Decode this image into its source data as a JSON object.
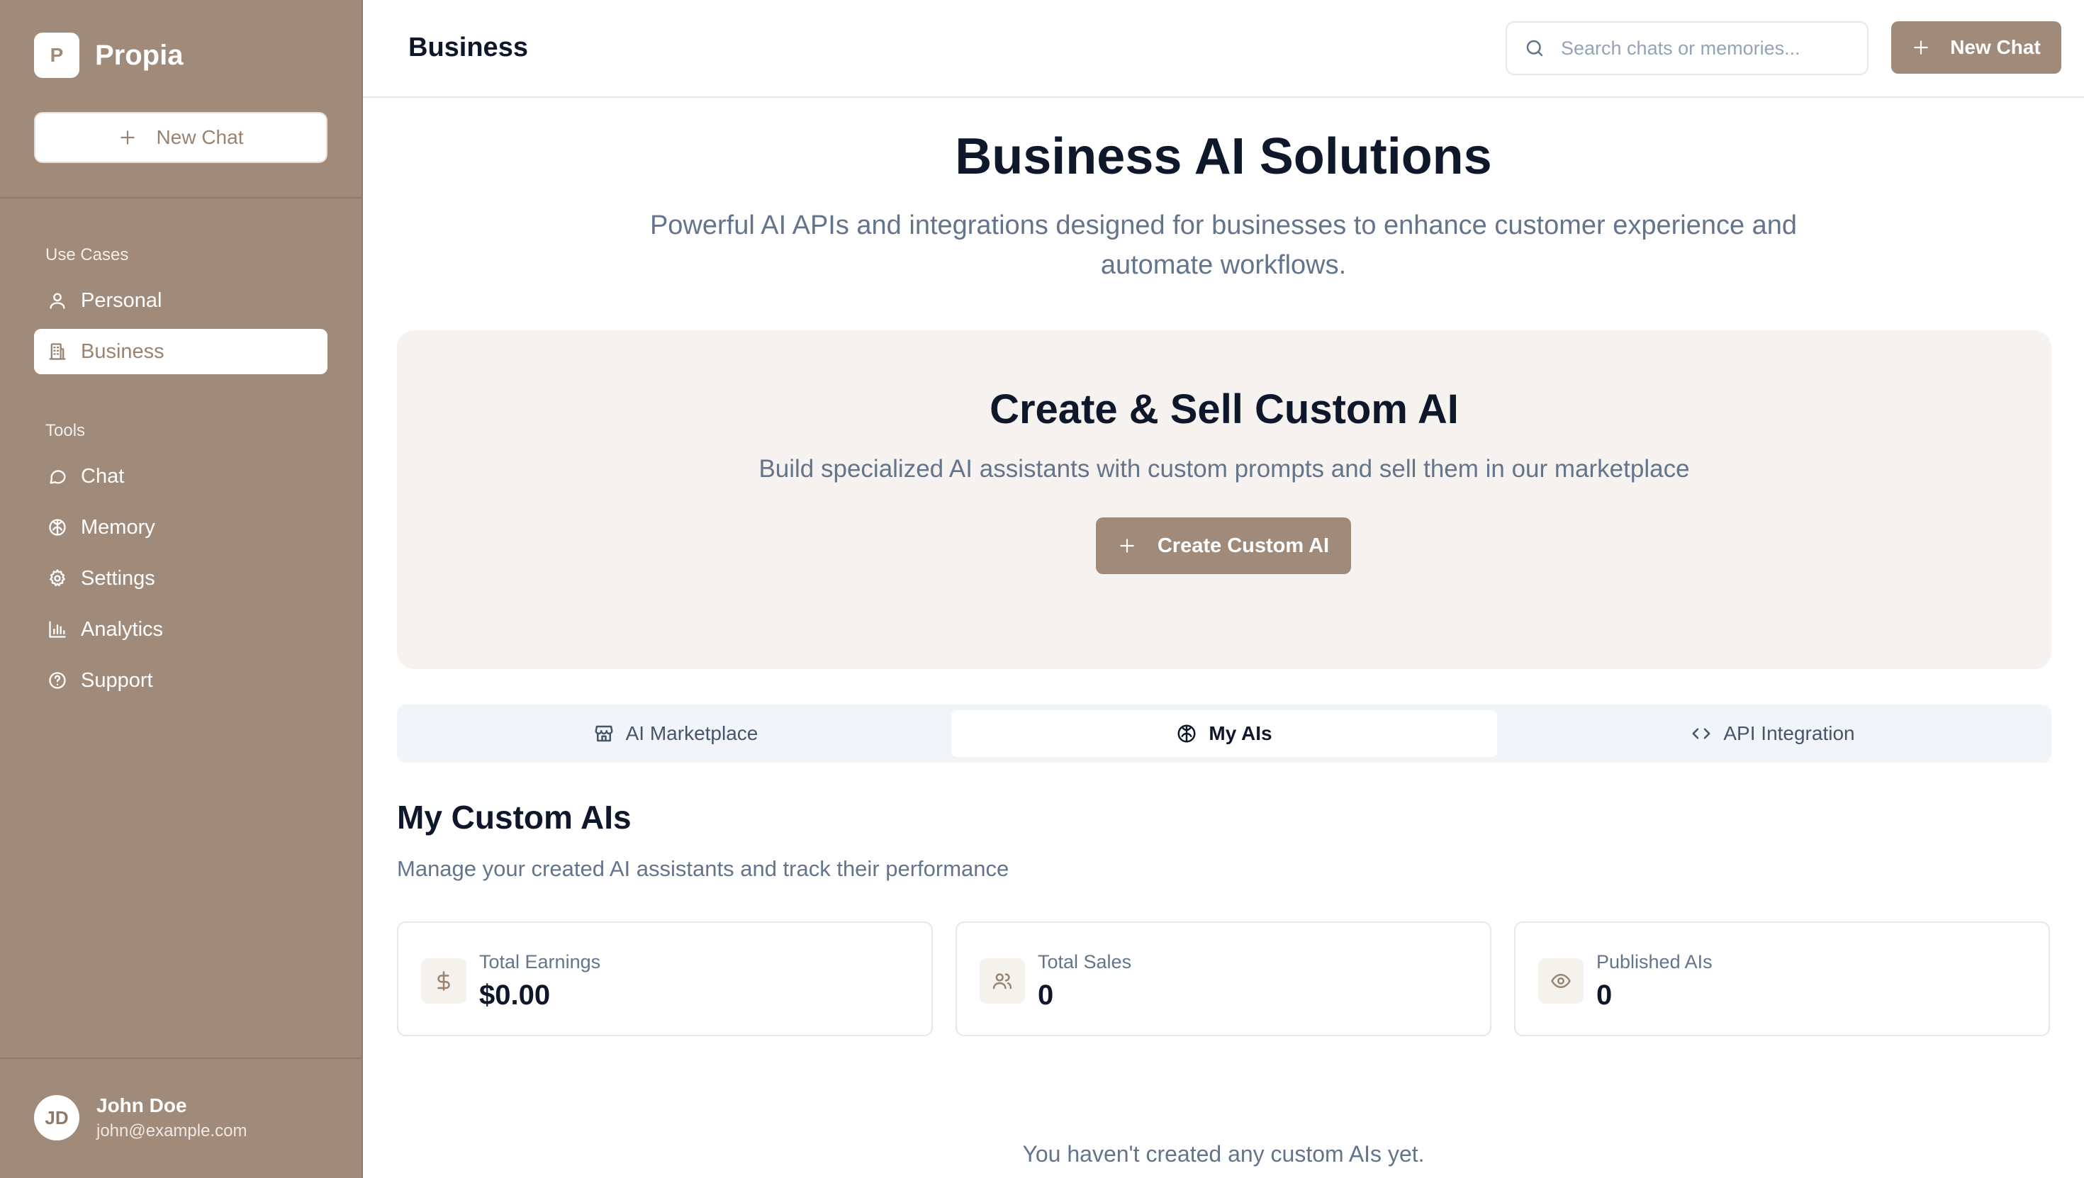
{
  "app": {
    "logo_letter": "P",
    "name": "Propia"
  },
  "sidebar": {
    "new_chat_label": "New Chat",
    "use_cases_label": "Use Cases",
    "use_cases": [
      {
        "label": "Personal",
        "icon": "user-icon"
      },
      {
        "label": "Business",
        "icon": "building-icon",
        "active": true
      }
    ],
    "tools_label": "Tools",
    "tools": [
      {
        "label": "Chat",
        "icon": "message-circle-icon"
      },
      {
        "label": "Memory",
        "icon": "brain-icon"
      },
      {
        "label": "Settings",
        "icon": "gear-icon"
      },
      {
        "label": "Analytics",
        "icon": "bar-chart-icon"
      },
      {
        "label": "Support",
        "icon": "help-circle-icon"
      }
    ],
    "user": {
      "initials": "JD",
      "name": "John Doe",
      "email": "john@example.com"
    }
  },
  "header": {
    "title": "Business",
    "search_placeholder": "Search chats or memories...",
    "new_chat_label": "New Chat"
  },
  "hero": {
    "title": "Business AI Solutions",
    "subtitle": "Powerful AI APIs and integrations designed for businesses to enhance customer experience and automate workflows."
  },
  "create_card": {
    "title": "Create & Sell Custom AI",
    "subtitle": "Build specialized AI assistants with custom prompts and sell them in our marketplace",
    "button_label": "Create Custom AI"
  },
  "tabs": [
    {
      "label": "AI Marketplace",
      "icon": "store-icon"
    },
    {
      "label": "My AIs",
      "icon": "brain-icon",
      "active": true
    },
    {
      "label": "API Integration",
      "icon": "code-icon"
    }
  ],
  "my_ais": {
    "title": "My Custom AIs",
    "subtitle": "Manage your created AI assistants and track their performance",
    "stats": [
      {
        "label": "Total Earnings",
        "value": "$0.00",
        "icon": "dollar-icon"
      },
      {
        "label": "Total Sales",
        "value": "0",
        "icon": "users-icon"
      },
      {
        "label": "Published AIs",
        "value": "0",
        "icon": "eye-icon"
      }
    ],
    "empty_text": "You haven't created any custom AIs yet."
  },
  "colors": {
    "brand": "#a08a79",
    "brand_text": "#9a8371",
    "muted_text": "#64748b"
  }
}
